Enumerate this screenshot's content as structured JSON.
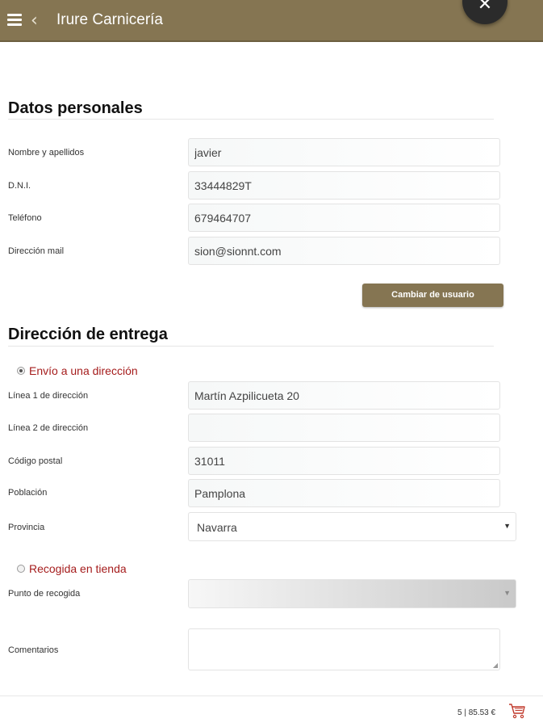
{
  "header": {
    "title": "Irure Carnicería",
    "menu_icon": "hamburger-menu-icon",
    "back_icon": "chevron-left-icon",
    "close_symbol": "✕",
    "back_symbol": "‹"
  },
  "personal": {
    "title": "Datos personales",
    "fields": [
      {
        "label": "Nombre y apellidos",
        "value": "javier"
      },
      {
        "label": "D.N.I.",
        "value": "33444829T"
      },
      {
        "label": "Teléfono",
        "value": "679464707"
      },
      {
        "label": "Dirección mail",
        "value": "sion@sionnt.com"
      }
    ],
    "change_user_label": "Cambiar de usuario"
  },
  "delivery": {
    "title": "Dirección de entrega",
    "option_address": "Envío a una dirección",
    "option_address_selected": true,
    "fields": [
      {
        "label": "Línea 1 de dirección",
        "value": "Martín Azpilicueta 20"
      },
      {
        "label": "Línea 2 de dirección",
        "value": ""
      },
      {
        "label": "Código postal",
        "value": "31011"
      },
      {
        "label": "Población",
        "value": "Pamplona"
      }
    ],
    "province_label": "Provincia",
    "province_value": "Navarra",
    "option_pickup": "Recogida en tienda",
    "option_pickup_selected": false,
    "pickup_point_label": "Punto de recogida",
    "pickup_point_value": "",
    "comments_label": "Comentarios",
    "comments_value": ""
  },
  "cart": {
    "summary": "5 | 85.53 €",
    "icon": "shopping-cart-icon"
  },
  "colors": {
    "brand": "#857552",
    "radio_label": "#a51c1c",
    "cart_icon": "#c0392b"
  }
}
